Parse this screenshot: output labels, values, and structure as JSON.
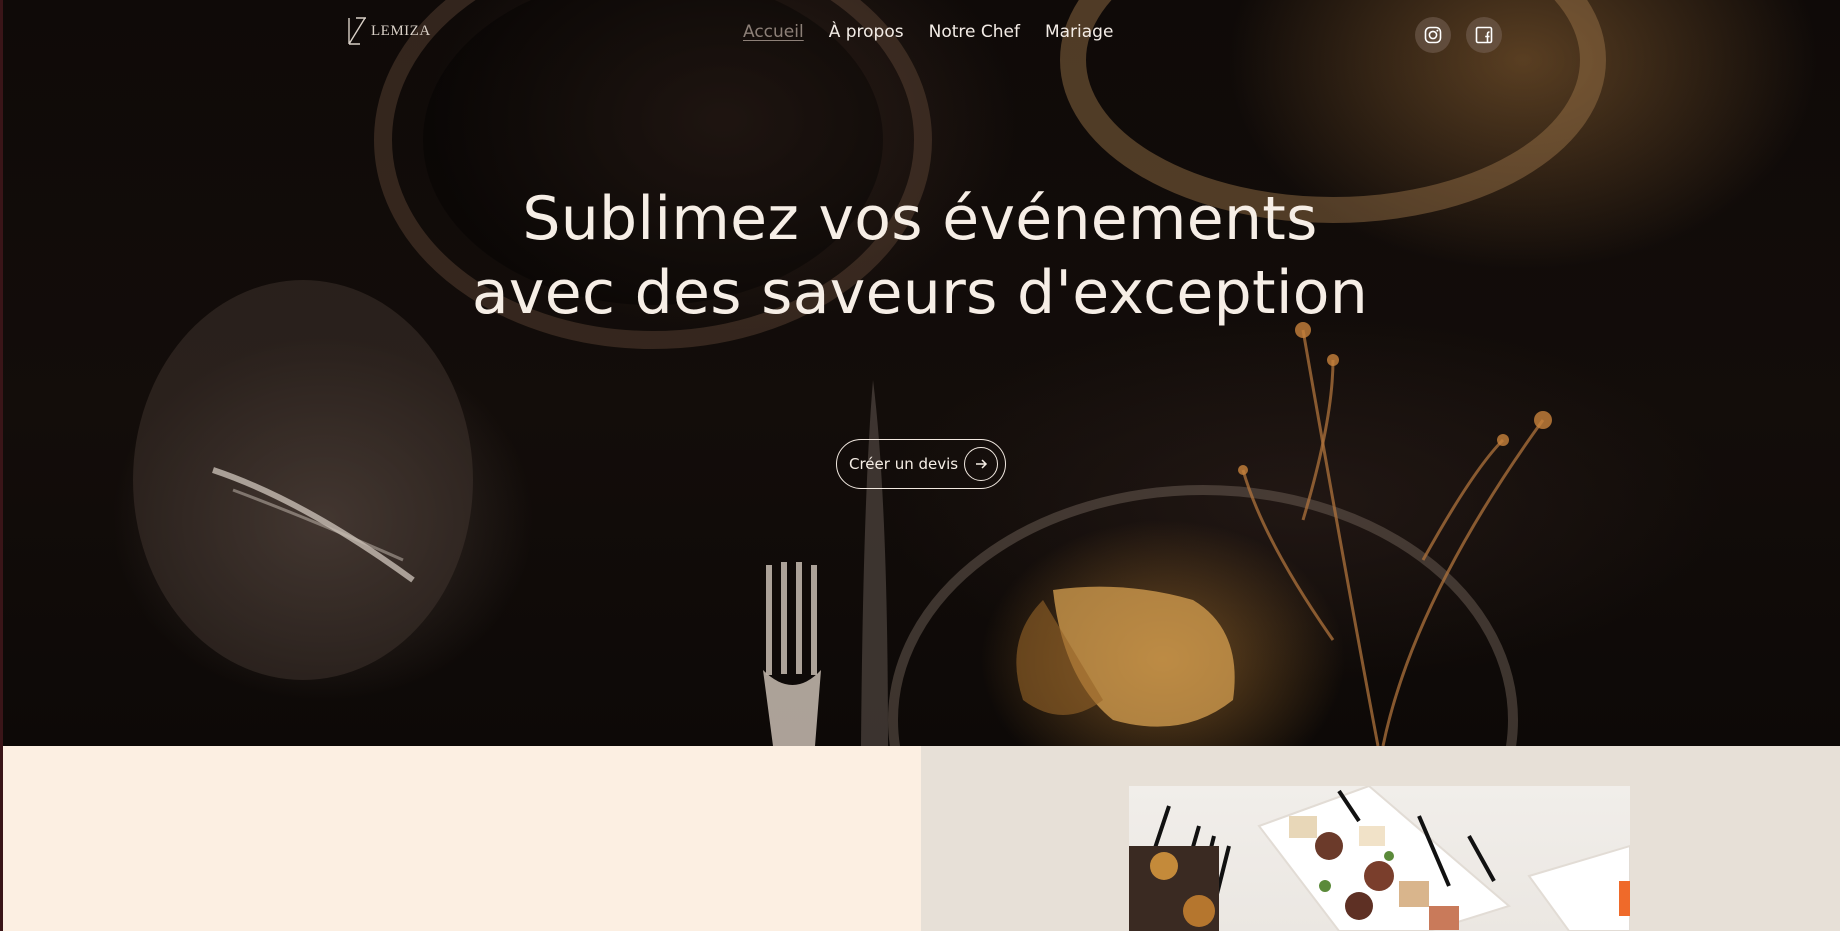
{
  "header": {
    "logo_text": "LEMIZA",
    "nav": [
      {
        "label": "Accueil",
        "active": true
      },
      {
        "label": "À propos",
        "active": false
      },
      {
        "label": "Notre Chef",
        "active": false
      },
      {
        "label": "Mariage",
        "active": false
      }
    ],
    "social": [
      {
        "icon": "instagram-icon"
      },
      {
        "icon": "facebook-icon"
      }
    ]
  },
  "hero": {
    "title_line1": "Sublimez vos événements",
    "title_line2": "avec des saveurs d'exception",
    "cta_label": "Créer un devis",
    "cta_icon": "arrow-right-icon"
  },
  "colors": {
    "hero_text": "#f6eee6",
    "section_left_bg": "#fcefe2",
    "section_right_bg": "#e7e0d7"
  }
}
